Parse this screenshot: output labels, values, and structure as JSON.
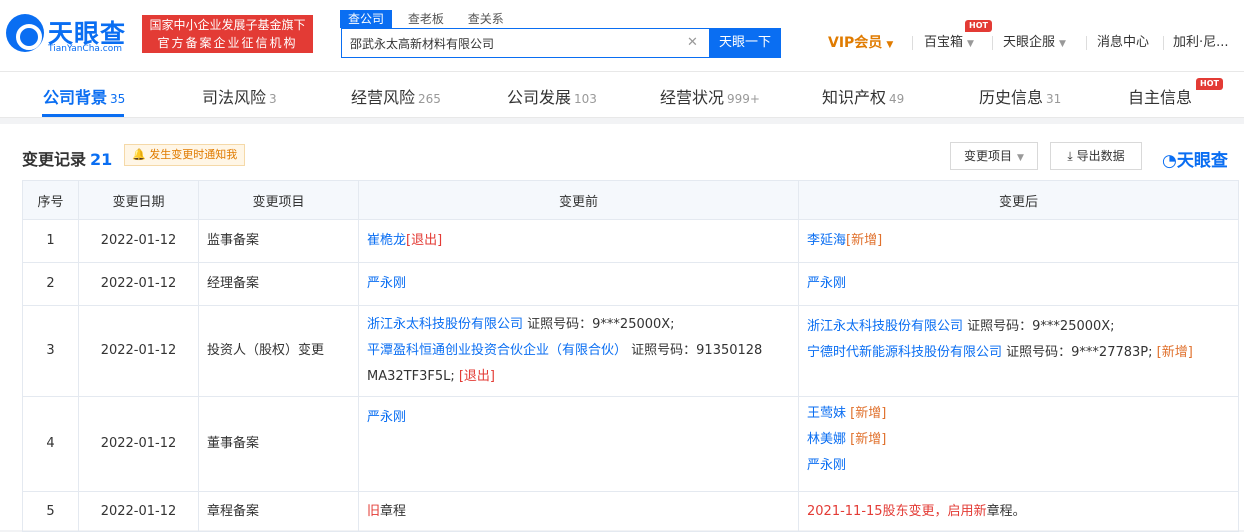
{
  "header": {
    "logo_text": "天眼查",
    "logo_sub": "TianYanCha.com",
    "badge_line1": "国家中小企业发展子基金旗下",
    "badge_line2": "官方备案企业征信机构",
    "search_tabs": [
      "查公司",
      "查老板",
      "查关系"
    ],
    "search_value": "邵武永太高新材料有限公司",
    "search_button": "天眼一下",
    "nav": {
      "vip": "VIP会员",
      "baibaoxiang": "百宝箱",
      "hot": "HOT",
      "qifu": "天眼企服",
      "messages": "消息中心",
      "user": "加利·尼..."
    }
  },
  "tabs": [
    {
      "label": "公司背景",
      "count": "35"
    },
    {
      "label": "司法风险",
      "count": "3"
    },
    {
      "label": "经营风险",
      "count": "265"
    },
    {
      "label": "公司发展",
      "count": "103"
    },
    {
      "label": "经营状况",
      "count": "999+"
    },
    {
      "label": "知识产权",
      "count": "49"
    },
    {
      "label": "历史信息",
      "count": "31"
    },
    {
      "label": "自主信息",
      "count": ""
    }
  ],
  "tabs_hot": "HOT",
  "section": {
    "title": "变更记录",
    "count": "21",
    "notify": "发生变更时通知我",
    "change_item_button": "变更项目",
    "export_button": "导出数据",
    "brand": "天眼查"
  },
  "table": {
    "headers": [
      "序号",
      "变更日期",
      "变更项目",
      "变更前",
      "变更后"
    ],
    "rows": [
      {
        "no": "1",
        "date": "2022-01-12",
        "item": "监事备案",
        "before": [
          {
            "name": "崔桅龙",
            "tag": "[退出]"
          }
        ],
        "after": [
          {
            "name": "李延海",
            "tag": "[新增]"
          }
        ]
      },
      {
        "no": "2",
        "date": "2022-01-12",
        "item": "经理备案",
        "before": [
          {
            "name": "严永刚",
            "tag": ""
          }
        ],
        "after": [
          {
            "name": "严永刚",
            "tag": ""
          }
        ]
      },
      {
        "no": "3",
        "date": "2022-01-12",
        "item": "投资人（股权）变更",
        "before_l1_name": "浙江永太科技股份有限公司",
        "before_l1_rest": " 证照号码：9***25000X;",
        "before_l2_name": "平潭盈科恒通创业投资合伙企业（有限合伙）",
        "before_l2_rest": " 证照号码：91350128",
        "before_l3": "MA32TF3F5L;",
        "before_l3_tag": "[退出]",
        "after_l1_name": "浙江永太科技股份有限公司",
        "after_l1_rest": " 证照号码：9***25000X;",
        "after_l2_name": "宁德时代新能源科技股份有限公司",
        "after_l2_rest": " 证照号码：9***27783P;",
        "after_l2_tag": "[新增]"
      },
      {
        "no": "4",
        "date": "2022-01-12",
        "item": "董事备案",
        "before": [
          {
            "name": "严永刚",
            "tag": ""
          }
        ],
        "after": [
          {
            "name": "王莺妹",
            "tag": "[新增]"
          },
          {
            "name": "林美娜",
            "tag": "[新增]"
          },
          {
            "name": "严永刚",
            "tag": ""
          }
        ]
      },
      {
        "no": "5",
        "date": "2022-01-12",
        "item": "章程备案",
        "before_hl": "旧",
        "before_text": "章程",
        "after_hl1": "2021-11-15股东变更，启用",
        "after_hl2": "新",
        "after_text": "章程。"
      }
    ]
  },
  "colors": {
    "brand": "#0a6ef2",
    "red": "#e33b35",
    "orange": "#e07b00"
  }
}
